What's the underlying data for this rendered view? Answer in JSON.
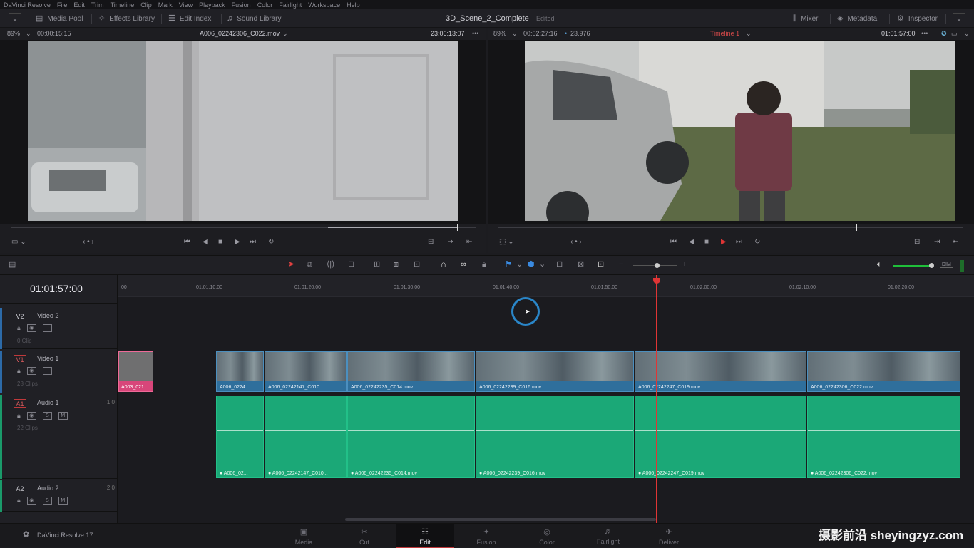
{
  "menu": [
    "DaVinci Resolve",
    "File",
    "Edit",
    "Trim",
    "Timeline",
    "Clip",
    "Mark",
    "View",
    "Playback",
    "Fusion",
    "Color",
    "Fairlight",
    "Workspace",
    "Help"
  ],
  "toolbar": {
    "media_pool": "Media Pool",
    "effects_library": "Effects Library",
    "edit_index": "Edit Index",
    "sound_library": "Sound Library",
    "project_title": "3D_Scene_2_Complete",
    "edited": "Edited",
    "mixer": "Mixer",
    "metadata": "Metadata",
    "inspector": "Inspector"
  },
  "source_viewer": {
    "zoom": "89%",
    "duration": "00:00:15:15",
    "clip_name": "A006_02242306_C022.mov",
    "timecode": "23:06:13:07",
    "playhead": 0.96
  },
  "timeline_viewer": {
    "zoom": "89%",
    "duration": "00:02:27:16",
    "fps": "23.976",
    "timeline_name": "Timeline 1",
    "timecode": "01:01:57:00",
    "playhead": 0.77
  },
  "timeline": {
    "timecode": "01:01:57:00",
    "ruler": [
      "00",
      "01:01:10:00",
      "01:01:20:00",
      "01:01:30:00",
      "01:01:40:00",
      "01:01:50:00",
      "01:02:00:00",
      "01:02:10:00",
      "01:02:20:00"
    ],
    "tracks": [
      {
        "id": "V2",
        "name": "Video 2",
        "count": "0 Clip",
        "vol": ""
      },
      {
        "id": "V1",
        "name": "Video 1",
        "count": "28 Clips",
        "vol": ""
      },
      {
        "id": "A1",
        "name": "Audio 1",
        "count": "22 Clips",
        "vol": "1.0"
      },
      {
        "id": "A2",
        "name": "Audio 2",
        "count": "",
        "vol": "2.0"
      }
    ],
    "pink_clip": "A003_021...",
    "video_clips": [
      "A006_0224...",
      "A006_02242147_C010...",
      "A006_02242235_C014.mov",
      "A006_02242239_C016.mov",
      "A006_02242247_C019.mov",
      "A006_02242306_C022.mov"
    ],
    "audio_clips": [
      "● A006_02...",
      "● A006_02242147_C010...",
      "● A006_02242235_C014.mov",
      "● A006_02242239_C016.mov",
      "● A006_02242247_C019.mov",
      "● A006_02242306_C022.mov"
    ]
  },
  "app_name": "DaVinci Resolve 17",
  "pages": [
    "Media",
    "Cut",
    "Edit",
    "Fusion",
    "Color",
    "Fairlight",
    "Deliver"
  ],
  "active_page": "Edit",
  "watermark": "摄影前沿 sheyingzyz.com",
  "colors": {
    "playhead": "#e03535",
    "video_clip": "#2f6f9c",
    "audio_clip": "#1ba877",
    "pink_clip": "#d8467a"
  }
}
